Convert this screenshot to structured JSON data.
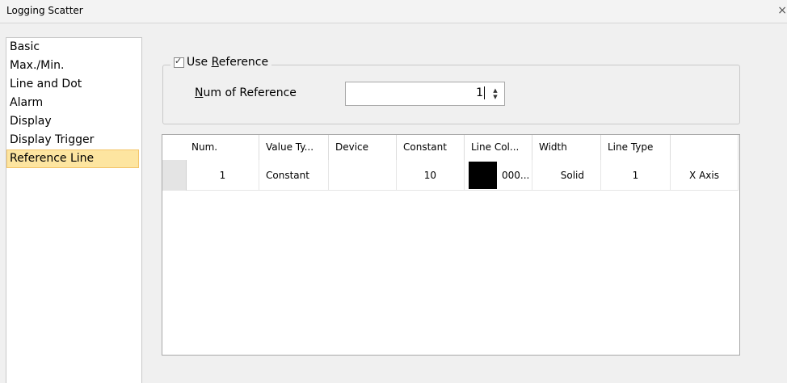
{
  "window": {
    "title": "Logging Scatter",
    "close_glyph": "×"
  },
  "sidebar": {
    "items": [
      {
        "label": "Basic",
        "selected": false
      },
      {
        "label": "Max./Min.",
        "selected": false
      },
      {
        "label": "Line and Dot",
        "selected": false
      },
      {
        "label": "Alarm",
        "selected": false
      },
      {
        "label": "Display",
        "selected": false
      },
      {
        "label": "Display Trigger",
        "selected": false
      },
      {
        "label": "Reference Line",
        "selected": true
      }
    ]
  },
  "reference": {
    "use_reference_checked": true,
    "use_reference_label_pre": "Use ",
    "use_reference_label_key": "R",
    "use_reference_label_post": "eference",
    "num_label_key": "N",
    "num_label_post": "um of Reference",
    "num_value": "1",
    "spin_up": "▲",
    "spin_down": "▼"
  },
  "table": {
    "headers": [
      "Num.",
      "Value Ty...",
      "Device",
      "Constant",
      "Line Col...",
      "Width",
      "Line Type",
      ""
    ],
    "rows": [
      {
        "num": "1",
        "value_type": "Constant",
        "device": "",
        "constant": "10",
        "line_color": "#000000",
        "line_color_text": "000...",
        "width": "Solid",
        "line_type": "1",
        "axis": "X Axis"
      }
    ]
  }
}
